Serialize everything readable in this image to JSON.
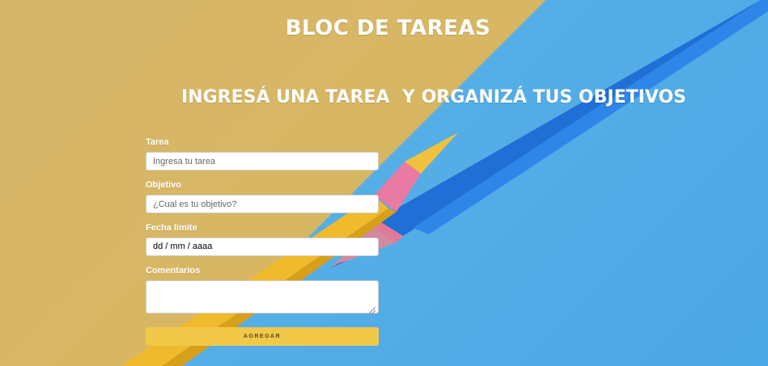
{
  "header": {
    "title": "BLOC DE TAREAS",
    "subtitle_left": "INGRESÁ UNA TAREA",
    "subtitle_right": "Y ORGANIZÁ TUS OBJETIVOS"
  },
  "form": {
    "task": {
      "label": "Tarea",
      "placeholder": "Ingresa tu tarea"
    },
    "objective": {
      "label": "Objetivo",
      "placeholder": "¿Cual es tu objetivo?"
    },
    "deadline": {
      "label": "Fecha limite",
      "value": "dd / mm / aaaa"
    },
    "comments": {
      "label": "Comentarios",
      "value": ""
    },
    "submit_label": "AGREGAR"
  },
  "colors": {
    "background_left": "#d6b66a",
    "background_right": "#4aa6e4",
    "button": "#f2c849"
  }
}
